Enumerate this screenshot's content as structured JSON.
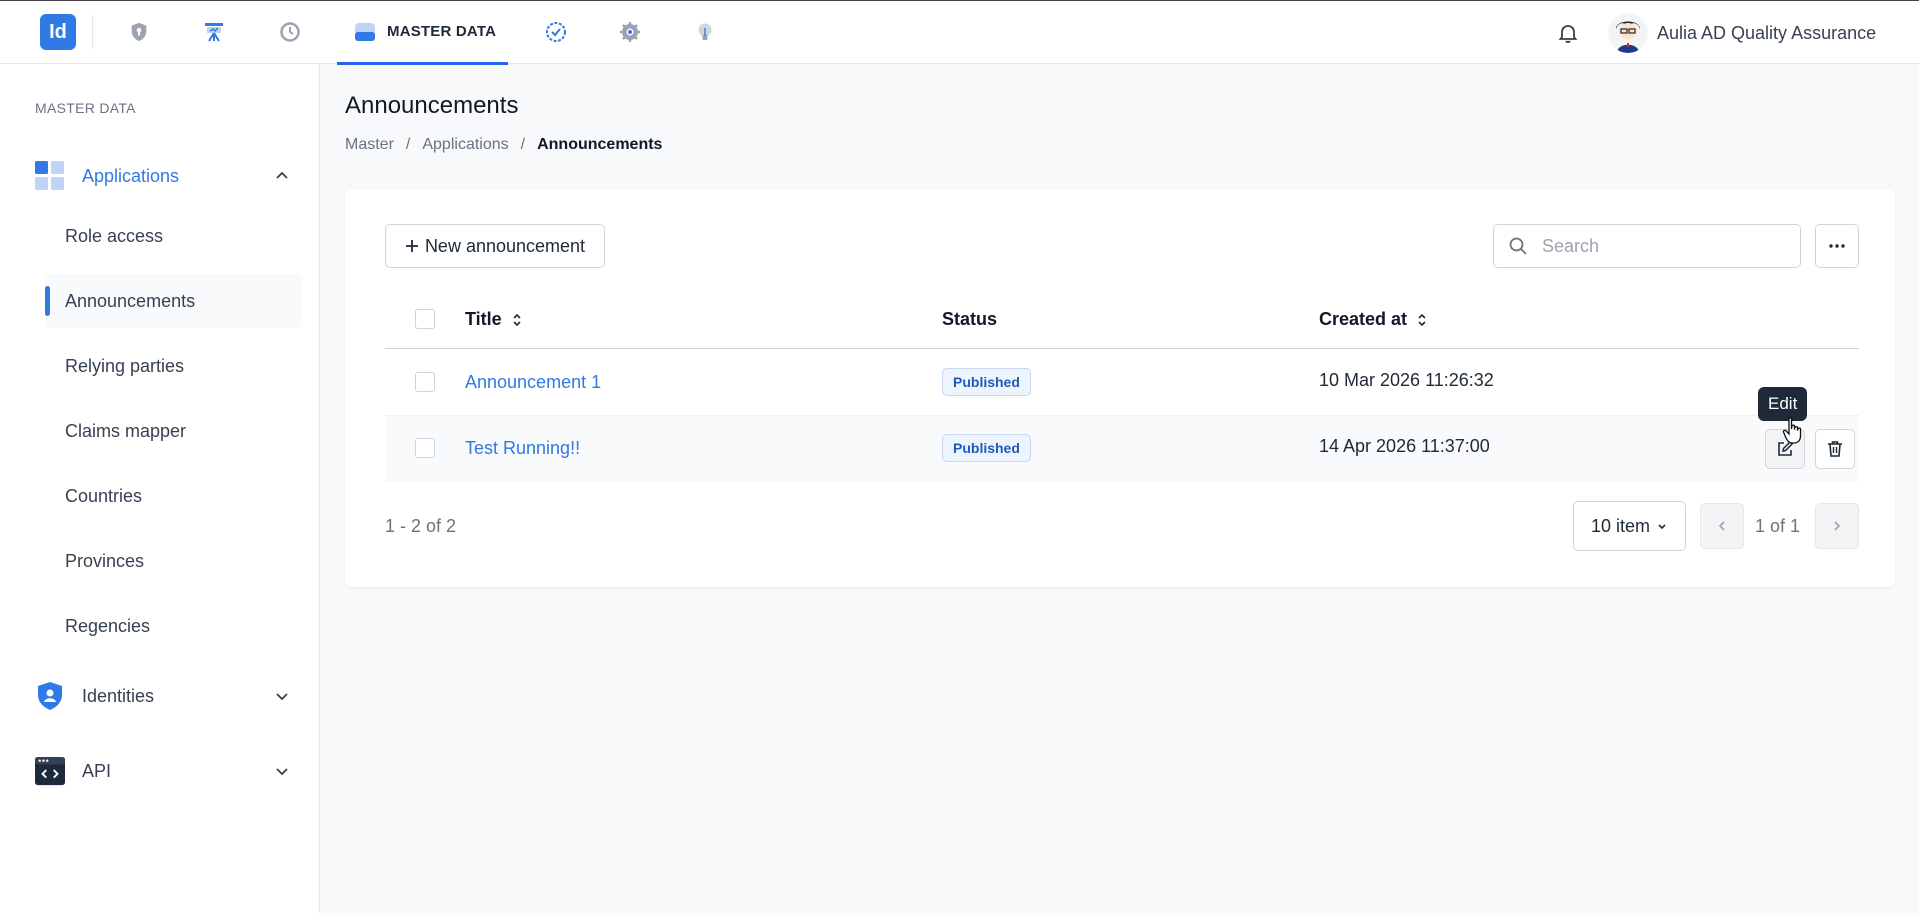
{
  "topbar": {
    "logo_text": "Id",
    "nav_items": [
      {
        "name": "shield-nav-icon"
      },
      {
        "name": "presentation-nav-icon"
      },
      {
        "name": "history-nav-icon"
      },
      {
        "name": "master-data-nav-icon",
        "label": "MASTER DATA",
        "active": true
      },
      {
        "name": "verified-nav-icon"
      },
      {
        "name": "settings-nav-icon"
      },
      {
        "name": "lightbulb-nav-icon"
      }
    ],
    "user_name": "Aulia AD Quality Assurance"
  },
  "sidebar": {
    "section_title": "MASTER DATA",
    "groups": [
      {
        "label": "Applications",
        "expanded": true,
        "icon": "applications-icon"
      },
      {
        "label": "Identities",
        "expanded": false,
        "icon": "identities-shield-icon"
      },
      {
        "label": "API",
        "expanded": false,
        "icon": "api-code-icon"
      }
    ],
    "items": [
      {
        "label": "Role access"
      },
      {
        "label": "Announcements",
        "active": true
      },
      {
        "label": "Relying parties"
      },
      {
        "label": "Claims mapper"
      },
      {
        "label": "Countries"
      },
      {
        "label": "Provinces"
      },
      {
        "label": "Regencies"
      }
    ]
  },
  "page": {
    "title": "Announcements",
    "breadcrumb": [
      "Master",
      "/",
      "Applications",
      "/",
      "Announcements"
    ]
  },
  "toolbar": {
    "new_button_label": "New announcement",
    "search_placeholder": "Search"
  },
  "table": {
    "columns": [
      "Title",
      "Status",
      "Created at"
    ],
    "rows": [
      {
        "title": "Announcement 1",
        "status": "Published",
        "created_at": "10 Mar 2026 11:26:32"
      },
      {
        "title": "Test Running!!",
        "status": "Published",
        "created_at": "14 Apr 2026 11:37:00"
      }
    ],
    "tooltip": "Edit"
  },
  "pagination": {
    "count_text": "1 - 2 of 2",
    "page_size": "10 item",
    "page_info": "1 of 1"
  },
  "colors": {
    "accent": "#2f7ae5",
    "badge_bg": "#eef4fd",
    "badge_text": "#1e5bb8"
  }
}
